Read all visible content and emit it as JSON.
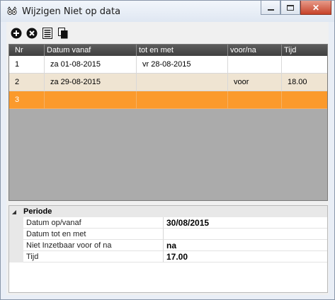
{
  "window": {
    "title": "Wijzigen Niet op data",
    "icon": "cat-app-icon"
  },
  "toolbar": {
    "buttons": [
      {
        "name": "add-button",
        "icon": "plus-circle-icon"
      },
      {
        "name": "delete-button",
        "icon": "x-circle-icon"
      },
      {
        "name": "list-button",
        "icon": "list-icon"
      },
      {
        "name": "copy-button",
        "icon": "copy-icon"
      }
    ]
  },
  "grid": {
    "columns": [
      "Nr",
      "Datum vanaf",
      "tot en met",
      "voor/na",
      "Tijd"
    ],
    "rows": [
      {
        "nr": "1",
        "datum_vanaf": "za 01-08-2015",
        "tot_en_met": "vr 28-08-2015",
        "voor_na": "",
        "tijd": ""
      },
      {
        "nr": "2",
        "datum_vanaf": "za 29-08-2015",
        "tot_en_met": "",
        "voor_na": "voor",
        "tijd": "18.00"
      },
      {
        "nr": "3",
        "datum_vanaf": "",
        "tot_en_met": "",
        "voor_na": "",
        "tijd": ""
      }
    ],
    "selected_row": 3,
    "selected_color": "#fb9a2c"
  },
  "properties": {
    "category": "Periode",
    "items": [
      {
        "name": "Datum op/vanaf",
        "value": "30/08/2015"
      },
      {
        "name": "Datum tot en met",
        "value": ""
      },
      {
        "name": "Niet Inzetbaar voor of na",
        "value": "na"
      },
      {
        "name": "Tijd",
        "value": "17.00"
      }
    ]
  }
}
